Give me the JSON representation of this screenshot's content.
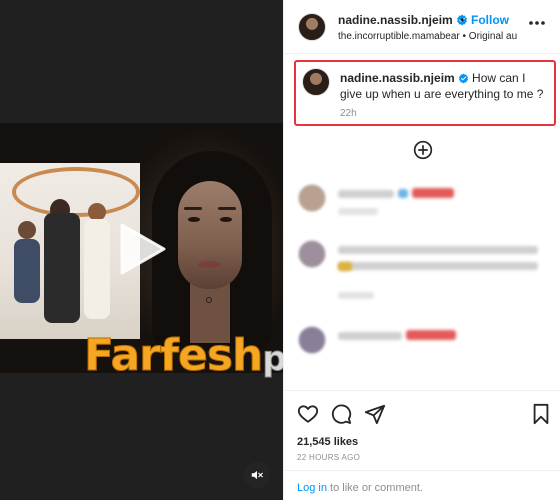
{
  "post": {
    "username": "nadine.nassib.njeim",
    "separator": "•",
    "follow_label": "Follow",
    "subtitle": "the.incorruptible.mamabear • Original au",
    "caption_text": "How can I give up when u are everything to me ?",
    "caption_time": "22h",
    "likes": "21,545 likes",
    "time_ago": "22 HOURS AGO"
  },
  "footer": {
    "login": "Log in",
    "rest": " to like or comment."
  },
  "watermark": {
    "part1": "Farfesh",
    "part2": "plus.com"
  },
  "icons": {
    "verified": "verified-badge-icon",
    "more": "more-options-icon",
    "add_comment": "plus-circle-icon",
    "like": "heart-icon",
    "comment": "comment-icon",
    "share": "paper-plane-icon",
    "save": "bookmark-icon",
    "mute": "speaker-muted-icon",
    "play": "play-icon"
  },
  "colors": {
    "accent_blue": "#0095f6",
    "highlight_red": "#e8323c",
    "muted_text": "#8e8e8e"
  }
}
